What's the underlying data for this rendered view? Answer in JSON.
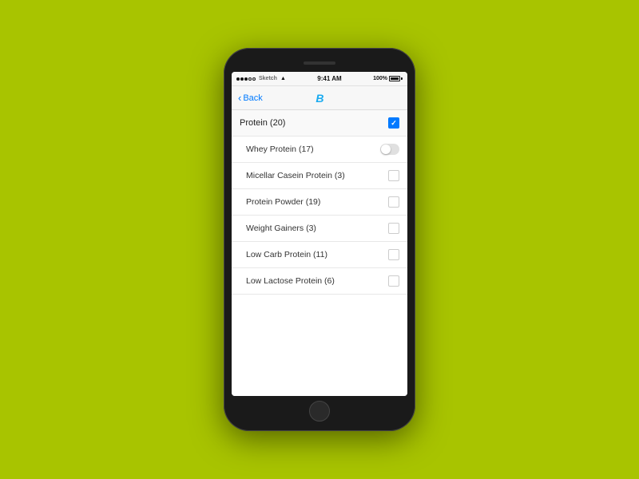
{
  "colors": {
    "background": "#a8c400",
    "accent": "#1aabf0",
    "checked": "#007aff"
  },
  "statusBar": {
    "network": "Sketch",
    "time": "9:41 AM",
    "battery": "100%"
  },
  "navBar": {
    "back_label": "Back",
    "logo": "B"
  },
  "listItems": [
    {
      "id": "protein",
      "label": "Protein (20)",
      "type": "parent",
      "checked": true,
      "toggle": false
    },
    {
      "id": "whey",
      "label": "Whey Protein (17)",
      "type": "child",
      "checked": false,
      "toggle": true
    },
    {
      "id": "micellar",
      "label": "Micellar Casein Protein (3)",
      "type": "child",
      "checked": false,
      "toggle": false
    },
    {
      "id": "powder",
      "label": "Protein Powder (19)",
      "type": "child",
      "checked": false,
      "toggle": false
    },
    {
      "id": "gainers",
      "label": "Weight Gainers (3)",
      "type": "child",
      "checked": false,
      "toggle": false
    },
    {
      "id": "lowcarb",
      "label": "Low Carb Protein (11)",
      "type": "child",
      "checked": false,
      "toggle": false
    },
    {
      "id": "lowlactose",
      "label": "Low Lactose Protein (6)",
      "type": "child",
      "checked": false,
      "toggle": false
    }
  ]
}
